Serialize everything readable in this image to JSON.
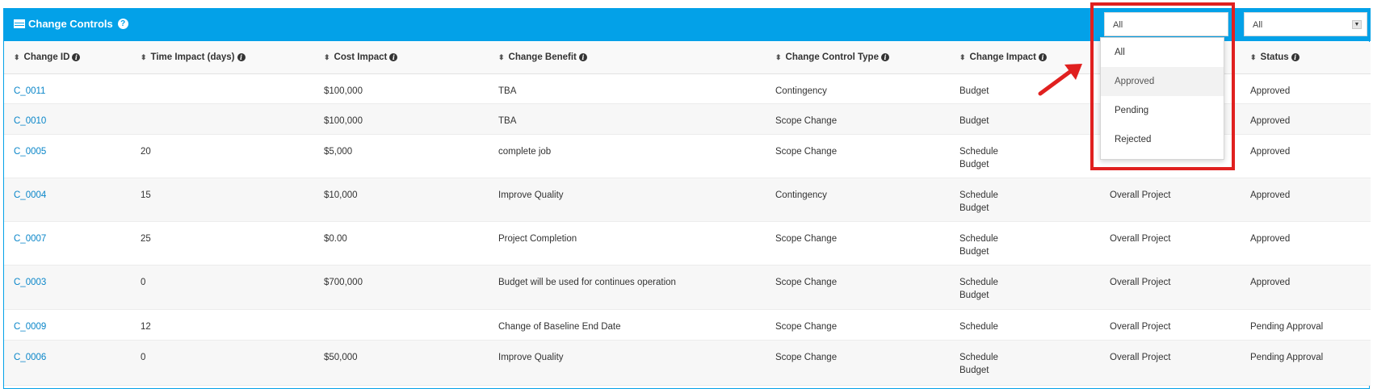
{
  "panel": {
    "title": "Change Controls",
    "help_glyph": "?",
    "accent_color": "#03a1e8"
  },
  "filters": {
    "approval_filter": {
      "value": "All",
      "options": [
        "All",
        "Approved",
        "Pending",
        "Rejected"
      ],
      "hovered_option": "Approved"
    },
    "status_filter": {
      "value": "All"
    }
  },
  "table": {
    "columns": [
      "Change ID",
      "Time Impact (days)",
      "Cost Impact",
      "Change Benefit",
      "Change Control Type",
      "Change Impact",
      "",
      "Status"
    ],
    "rows": [
      {
        "id": "C_0011",
        "time": "",
        "cost": "$100,000",
        "benefit": "TBA",
        "type": "Contingency",
        "impact": [
          "Budget"
        ],
        "scope": "",
        "status": "Approved"
      },
      {
        "id": "C_0010",
        "time": "",
        "cost": "$100,000",
        "benefit": "TBA",
        "type": "Scope Change",
        "impact": [
          "Budget"
        ],
        "scope": "",
        "status": "Approved"
      },
      {
        "id": "C_0005",
        "time": "20",
        "cost": "$5,000",
        "benefit": "complete job",
        "type": "Scope Change",
        "impact": [
          "Schedule",
          "Budget"
        ],
        "scope": "",
        "status": "Approved"
      },
      {
        "id": "C_0004",
        "time": "15",
        "cost": "$10,000",
        "benefit": "Improve Quality",
        "type": "Contingency",
        "impact": [
          "Schedule",
          "Budget"
        ],
        "scope": "Overall Project",
        "status": "Approved"
      },
      {
        "id": "C_0007",
        "time": "25",
        "cost": "$0.00",
        "benefit": "Project Completion",
        "type": "Scope Change",
        "impact": [
          "Schedule",
          "Budget"
        ],
        "scope": "Overall Project",
        "status": "Approved"
      },
      {
        "id": "C_0003",
        "time": "0",
        "cost": "$700,000",
        "benefit": "Budget will be used for continues operation",
        "type": "Scope Change",
        "impact": [
          "Schedule",
          "Budget"
        ],
        "scope": "Overall Project",
        "status": "Approved"
      },
      {
        "id": "C_0009",
        "time": "12",
        "cost": "",
        "benefit": "Change of Baseline End Date",
        "type": "Scope Change",
        "impact": [
          "Schedule"
        ],
        "scope": "Overall Project",
        "status": "Pending Approval"
      },
      {
        "id": "C_0006",
        "time": "0",
        "cost": "$50,000",
        "benefit": "Improve Quality",
        "type": "Scope Change",
        "impact": [
          "Schedule",
          "Budget"
        ],
        "scope": "Overall Project",
        "status": "Pending Approval"
      }
    ]
  },
  "annotation": {
    "highlight_color": "#e0201f"
  }
}
